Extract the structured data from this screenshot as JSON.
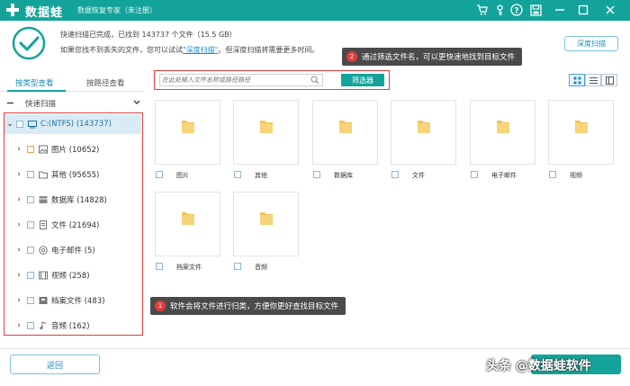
{
  "titlebar": {
    "brand": "数据蛙",
    "subtitle": "数据恢复专家（未注册）",
    "bg_color": "#14a39a"
  },
  "status": {
    "line1": "快速扫描已完成，已找到 143737 个文件（15.5 GB）",
    "line2_pre": "如果您找不到丢失的文件，您可以试试",
    "line2_link": "\"深度扫描\"",
    "line2_post": "。但深度扫描将需要更多时间。",
    "deep_scan_label": "深度扫描"
  },
  "tooltips": {
    "tip1_num": "1",
    "tip1_text": "软件会将文件进行归类，方便你更好查找目标文件",
    "tip2_num": "2",
    "tip2_text": "通过筛选文件名，可以更快速地找到目标文件"
  },
  "sidebar": {
    "tab_type": "按类型查看",
    "tab_path": "按路径查看",
    "quick_scan": "快速扫描",
    "root": "C:(NTFS) (143737)",
    "items": [
      {
        "label": "图片 (10652)",
        "icon": "image-icon"
      },
      {
        "label": "其他 (95655)",
        "icon": "folder-icon"
      },
      {
        "label": "数据库 (14828)",
        "icon": "database-icon"
      },
      {
        "label": "文件 (21694)",
        "icon": "document-icon"
      },
      {
        "label": "电子邮件 (5)",
        "icon": "email-icon"
      },
      {
        "label": "视频 (258)",
        "icon": "video-icon"
      },
      {
        "label": "档案文件 (483)",
        "icon": "archive-icon"
      },
      {
        "label": "音频 (162)",
        "icon": "audio-icon"
      }
    ]
  },
  "toolbar": {
    "search_placeholder": "在此处输入文件名称或路径路径",
    "filter_label": "筛选器"
  },
  "grid": {
    "folders": [
      "图片",
      "其他",
      "数据库",
      "文件",
      "电子邮件",
      "视频",
      "档案文件",
      "音频"
    ]
  },
  "footer": {
    "back_label": "返回",
    "watermark": "头条 @数据蛙软件"
  }
}
